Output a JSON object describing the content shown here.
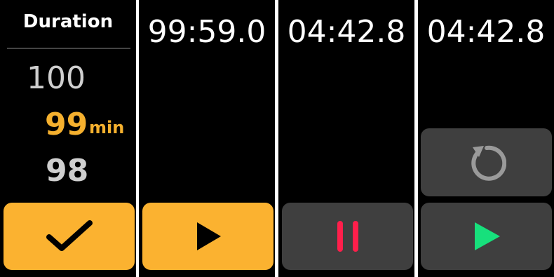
{
  "picker": {
    "title": "Duration",
    "value_above": "100",
    "value_selected": "99",
    "unit": "min",
    "value_below": "98"
  },
  "timers": {
    "ready": "99:59.0",
    "running": "04:42.8",
    "paused": "04:42.8"
  },
  "icons": {
    "confirm": "check-icon",
    "start": "play-icon",
    "pause": "pause-icon",
    "reset": "reset-icon",
    "resume": "play-icon"
  },
  "colors": {
    "accent": "#fbb230",
    "picker_selected": "#f5b02e",
    "pause": "#ff1f4b",
    "resume": "#17e07c",
    "button_gray": "#3f3f3f",
    "reset_icon": "#9a9a9a"
  }
}
